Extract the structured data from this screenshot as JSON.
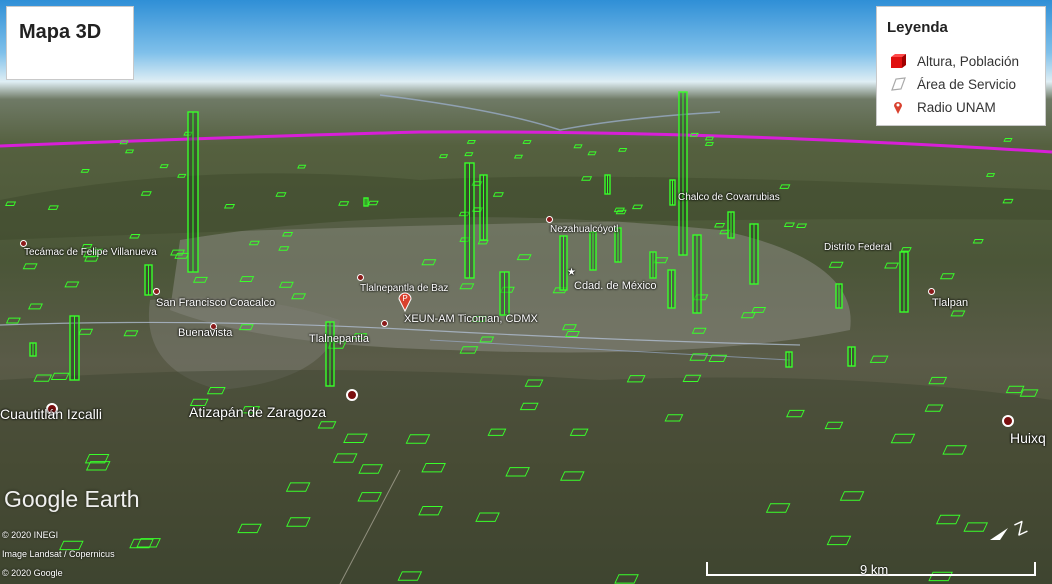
{
  "title": "Mapa 3D",
  "legend": {
    "title": "Leyenda",
    "items": [
      {
        "label": "Altura, Población",
        "icon": "red-cube-icon",
        "color": "#e01010"
      },
      {
        "label": "Área de Servicio",
        "icon": "outline-polygon-icon",
        "color": "#bbbbbb"
      },
      {
        "label": "Radio UNAM",
        "icon": "map-pin-icon",
        "color": "#d9412e"
      }
    ]
  },
  "places": {
    "tecamac": "Tecámac de Felipe Villanueva",
    "coacalco": "San Francisco Coacalco",
    "buenavista": "Buenavista",
    "tlalnepantla_baz": "Tlalnepantla de Baz",
    "xeun": "XEUN-AM Ticoman, CDMX",
    "tlalnepantla": "Tlalnepantla",
    "cuautitlan": "Cuautitlán Izcalli",
    "atizapan": "Atizapán de Zaragoza",
    "nezahualcoyotl": "Nezahualcóyotl",
    "cdmx": "Cdad. de México",
    "chalco": "Chalco de Covarrubias",
    "df": "Distrito Federal",
    "tlalpan": "Tlalpan",
    "huixquilucan": "Huixq"
  },
  "branding": {
    "logo": "Google Earth",
    "credits": [
      "© 2020 INEGI",
      "Image Landsat / Copernicus",
      "© 2020 Google"
    ]
  },
  "scale": {
    "label": "9 km"
  },
  "colors": {
    "accent_green": "#39ff2a",
    "boundary_magenta": "#d81fd8",
    "pin_red": "#d9412e"
  }
}
